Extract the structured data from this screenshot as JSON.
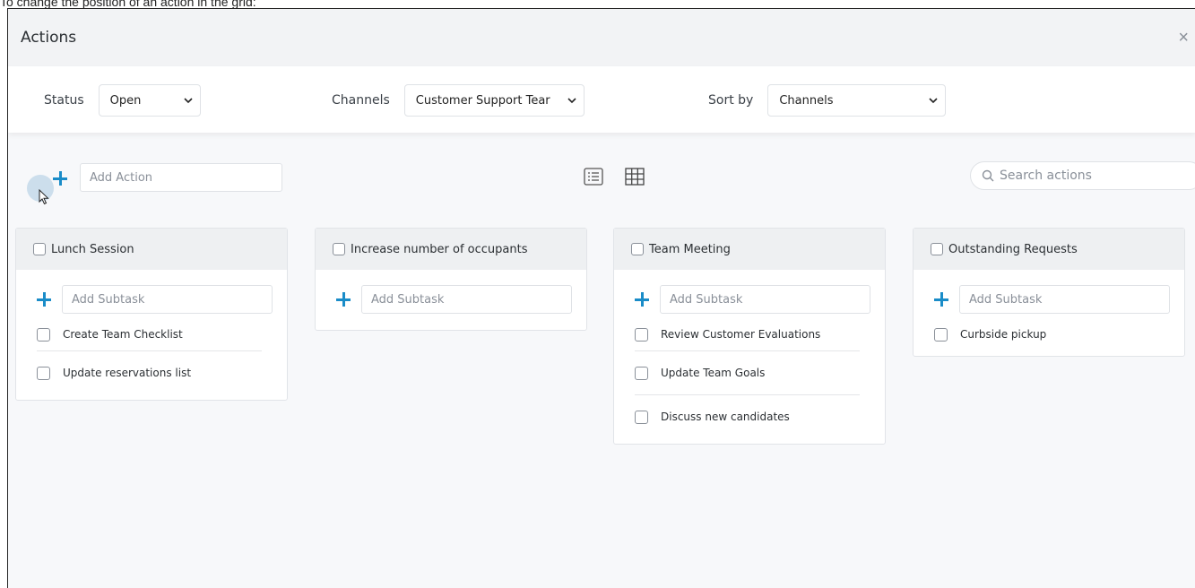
{
  "caption": "To change the position of an action in the grid:",
  "modal": {
    "title": "Actions",
    "close_glyph": "×"
  },
  "filters": {
    "status_label": "Status",
    "status_value": "Open",
    "channels_label": "Channels",
    "channels_value": "Customer Support Tear",
    "sort_label": "Sort by",
    "sort_value": "Channels"
  },
  "toolbar": {
    "add_action_placeholder": "Add Action",
    "search_placeholder": "Search actions",
    "icons": [
      "plus-icon",
      "list-view-icon",
      "grid-view-icon",
      "search-icon"
    ]
  },
  "cards": [
    {
      "title": "Lunch Session",
      "add_subtask_placeholder": "Add Subtask",
      "items": [
        "Create Team Checklist",
        "Update reservations list"
      ]
    },
    {
      "title": "Increase number of occupants",
      "add_subtask_placeholder": "Add Subtask",
      "items": []
    },
    {
      "title": "Team Meeting",
      "add_subtask_placeholder": "Add Subtask",
      "items": [
        "Review Customer Evaluations",
        "Update Team Goals",
        "Discuss new candidates"
      ]
    },
    {
      "title": "Outstanding Requests",
      "add_subtask_placeholder": "Add Subtask",
      "items": [
        "Curbside pickup"
      ]
    }
  ],
  "colors": {
    "accent": "#1a8cc8",
    "header_bg": "#f2f3f5",
    "card_head_bg": "#eef0f2"
  }
}
